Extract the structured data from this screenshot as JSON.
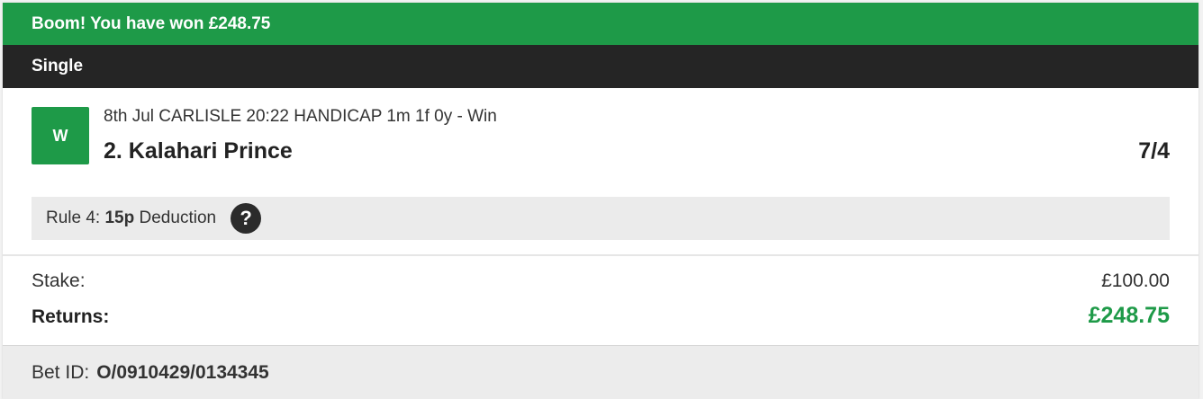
{
  "banner": {
    "text": "Boom! You have won £248.75",
    "color": "#1e9a48"
  },
  "bet_type": "Single",
  "selection": {
    "result_badge": "W",
    "event": "8th Jul CARLISLE 20:22 HANDICAP 1m 1f 0y - Win",
    "runner": "2. Kalahari Prince",
    "odds": "7/4"
  },
  "rule4": {
    "prefix": "Rule 4:",
    "amount": "15p",
    "suffix": "Deduction",
    "help_icon": "question-icon",
    "help_glyph": "?"
  },
  "totals": {
    "stake_label": "Stake:",
    "stake_value": "£100.00",
    "returns_label": "Returns:",
    "returns_value": "£248.75",
    "returns_color": "#1e9a48"
  },
  "footer": {
    "bet_id_label": "Bet ID:",
    "bet_id_value": "O/0910429/0134345"
  }
}
